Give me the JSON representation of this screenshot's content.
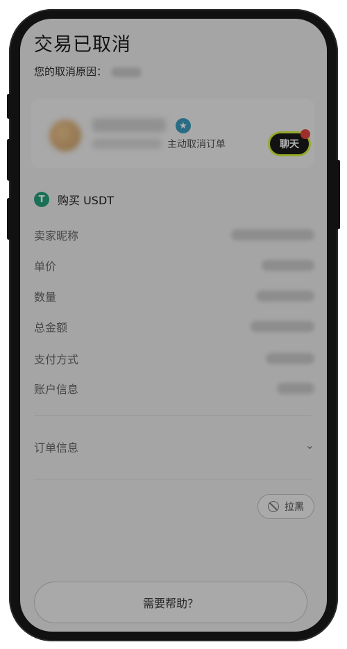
{
  "header": {
    "title": "交易已取消",
    "reason_label": "您的取消原因："
  },
  "seller_card": {
    "cancel_text": "主动取消订单",
    "chat_label": "聊天"
  },
  "order": {
    "buy_label": "购买 USDT",
    "tether_glyph": "T",
    "details": [
      {
        "label": "卖家昵称"
      },
      {
        "label": "单价"
      },
      {
        "label": "数量"
      },
      {
        "label": "总金额"
      },
      {
        "label": "支付方式"
      },
      {
        "label": "账户信息"
      }
    ],
    "order_info_label": "订单信息"
  },
  "actions": {
    "block_label": "拉黑",
    "help_label": "需要帮助？"
  },
  "colors": {
    "tether": "#26a17b",
    "chat_highlight": "#d7f23a",
    "notification_dot": "#e2443f"
  }
}
